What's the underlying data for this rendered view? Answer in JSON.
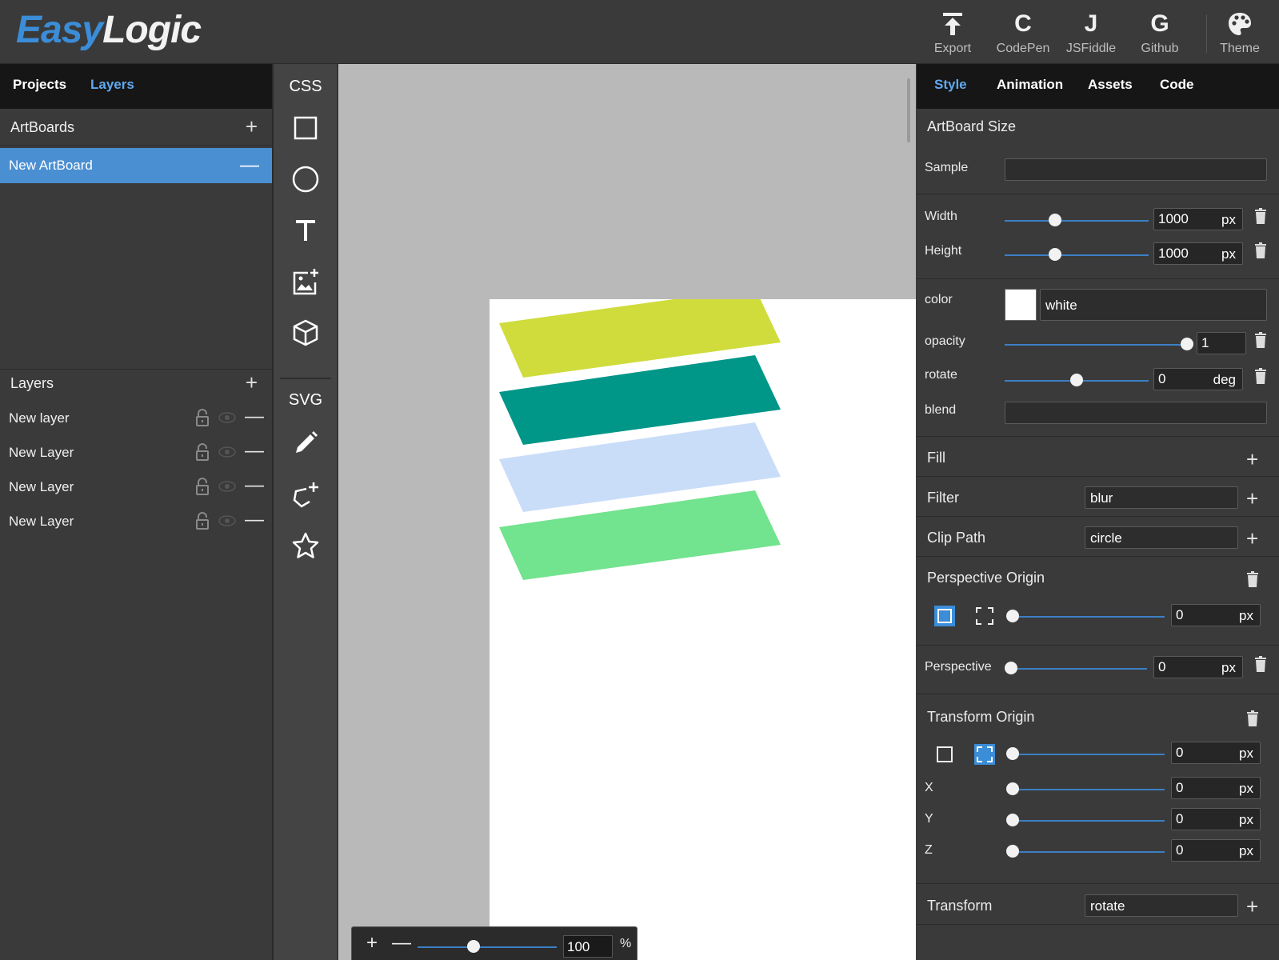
{
  "app": {
    "logo_easy": "Easy",
    "logo_logic": "Logic"
  },
  "header": {
    "buttons": [
      {
        "label": "Export",
        "glyph": "",
        "icon": "export-icon"
      },
      {
        "label": "CodePen",
        "glyph": "C",
        "icon": "codepen-icon"
      },
      {
        "label": "JSFiddle",
        "glyph": "J",
        "icon": "jsfiddle-icon"
      },
      {
        "label": "Github",
        "glyph": "G",
        "icon": "github-icon"
      },
      {
        "label": "Theme",
        "glyph": "",
        "icon": "palette-icon"
      }
    ]
  },
  "left": {
    "tabs": [
      {
        "label": "Projects",
        "active": false
      },
      {
        "label": "Layers",
        "active": true
      }
    ],
    "artboards_title": "ArtBoards",
    "artboard_selected": "New ArtBoard",
    "layers_title": "Layers",
    "layers": [
      {
        "label": "New layer"
      },
      {
        "label": "New Layer"
      },
      {
        "label": "New Layer"
      },
      {
        "label": "New Layer"
      }
    ],
    "add_glyph": "+",
    "remove_glyph": "—"
  },
  "tools": {
    "css_label": "CSS",
    "svg_label": "SVG",
    "items": [
      "square-icon",
      "circle-icon",
      "text-icon",
      "image-add-icon",
      "cube-icon",
      "pencil-icon",
      "path-add-icon",
      "star-icon"
    ]
  },
  "canvas": {
    "shapes": [
      {
        "name": "shape-yellow",
        "color": "#cfdc3c"
      },
      {
        "name": "shape-teal",
        "color": "#009688"
      },
      {
        "name": "shape-lightblue",
        "color": "#c9ddf9"
      },
      {
        "name": "shape-green",
        "color": "#72e38e"
      }
    ],
    "zoom": {
      "plus": "+",
      "minus": "—",
      "value": "100",
      "unit": "%",
      "level": 0.4
    }
  },
  "right": {
    "tabs": [
      {
        "label": "Style",
        "active": true
      },
      {
        "label": "Animation",
        "active": false
      },
      {
        "label": "Assets",
        "active": false
      },
      {
        "label": "Code",
        "active": false
      }
    ],
    "artboard_size_title": "ArtBoard Size",
    "sample_label": "Sample",
    "sample_value": "",
    "width": {
      "label": "Width",
      "value": "1000",
      "unit": "px",
      "level": 0.35
    },
    "height": {
      "label": "Height",
      "value": "1000",
      "unit": "px",
      "level": 0.35
    },
    "color": {
      "label": "color",
      "value": "white",
      "swatch": "#ffffff"
    },
    "opacity": {
      "label": "opacity",
      "value": "1",
      "unit": "",
      "level": 1.0
    },
    "rotate": {
      "label": "rotate",
      "value": "0",
      "unit": "deg",
      "level": 0.5
    },
    "blend": {
      "label": "blend",
      "value": ""
    },
    "fill_title": "Fill",
    "filter": {
      "title": "Filter",
      "value": "blur"
    },
    "clip_path": {
      "title": "Clip Path",
      "value": "circle"
    },
    "perspective_origin": {
      "title": "Perspective Origin",
      "value": "0",
      "unit": "px",
      "level": 0.0
    },
    "perspective": {
      "label": "Perspective",
      "value": "0",
      "unit": "px",
      "level": 0.0
    },
    "transform_origin": {
      "title": "Transform Origin",
      "all": {
        "value": "0",
        "unit": "px",
        "level": 0.0
      },
      "x": {
        "label": "X",
        "value": "0",
        "unit": "px",
        "level": 0.0
      },
      "y": {
        "label": "Y",
        "value": "0",
        "unit": "px",
        "level": 0.0
      },
      "z": {
        "label": "Z",
        "value": "0",
        "unit": "px",
        "level": 0.0
      }
    },
    "transform": {
      "title": "Transform",
      "value": "rotate"
    },
    "add_glyph": "+"
  },
  "colors": {
    "accent": "#4a8fd2",
    "active_tab": "#5fa9ef",
    "panel": "#3a3a3a",
    "tabbar": "#161616"
  }
}
